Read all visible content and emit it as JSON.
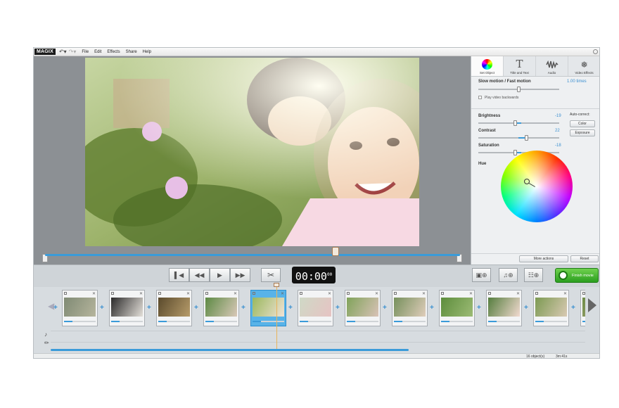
{
  "menubar": {
    "logo": "MAGIX",
    "menus": [
      "File",
      "Edit",
      "Effects",
      "Share",
      "Help"
    ]
  },
  "panel": {
    "tabs": [
      {
        "label": "Set Object",
        "icon": "color-wheel-icon"
      },
      {
        "label": "Title and Text",
        "icon": "text-T-icon"
      },
      {
        "label": "Audio",
        "icon": "waveform-icon"
      },
      {
        "label": "Video Effects",
        "icon": "sparkle-icon"
      }
    ],
    "speed_label": "Slow motion / Fast motion",
    "speed_value": "1.00 times",
    "speed_level": 0.5,
    "play_backwards": "Play video backwards",
    "auto_correct": "Auto-correct:",
    "color_btn": "Color",
    "exposure_btn": "Exposure",
    "brightness_label": "Brightness",
    "brightness_value": "-19",
    "brightness_level": 0.45,
    "contrast_label": "Contrast",
    "contrast_value": "22",
    "contrast_level": 0.6,
    "saturation_label": "Saturation",
    "saturation_value": "-18",
    "saturation_level": 0.45,
    "hue_label": "Hue",
    "more_actions": "More actions",
    "reset": "Reset"
  },
  "transport": {
    "timecode": "00:00",
    "timecode_frames": "00",
    "finish_label": "Finish movie"
  },
  "scrub_position": 0.72,
  "storyboard": {
    "clip_count": 12,
    "selected_clip": 4,
    "status_objects": "16 object(s)",
    "status_duration": "3m:41s",
    "scroll_level": 0.67
  }
}
